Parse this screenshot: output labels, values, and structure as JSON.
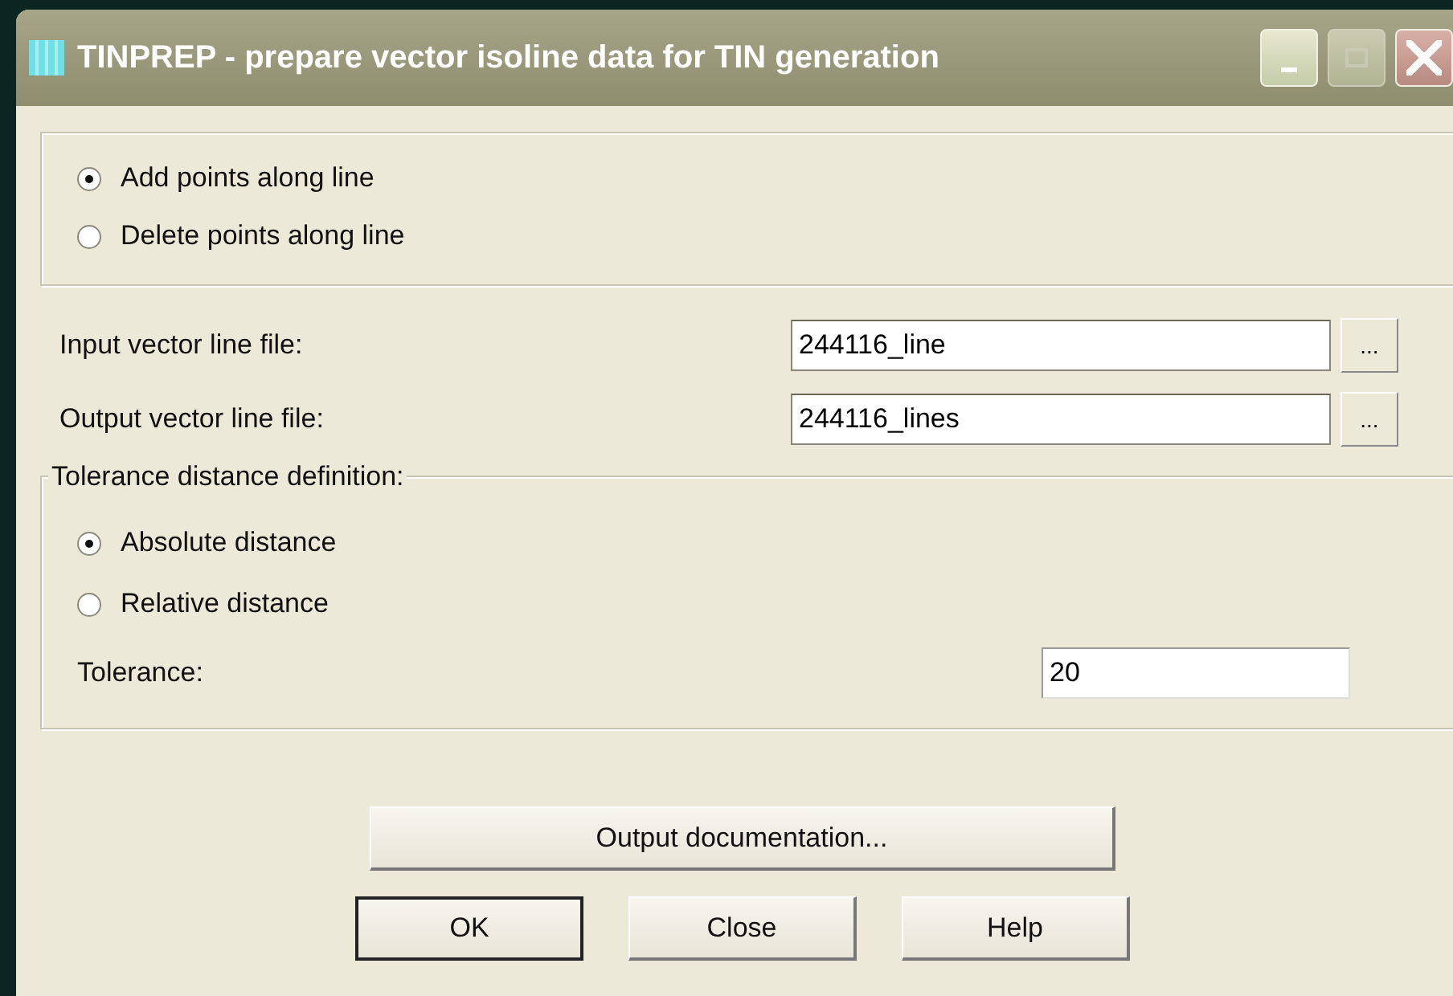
{
  "window": {
    "title": "TINPREP - prepare vector isoline data for TIN generation",
    "buttons": [
      {
        "kind": "minimize",
        "disabled": false
      },
      {
        "kind": "maximize",
        "disabled": true
      },
      {
        "kind": "close",
        "disabled": false
      }
    ]
  },
  "mode": [
    {
      "label": "Add points along line",
      "selected": true
    },
    {
      "label": "Delete points along line",
      "selected": false
    }
  ],
  "files": [
    {
      "label": "Input vector line file:",
      "value": "244116_line",
      "browse": "..."
    },
    {
      "label": "Output vector line file:",
      "value": "244116_lines",
      "browse": "..."
    }
  ],
  "tolerance_group": {
    "legend": "Tolerance distance definition:",
    "options": [
      {
        "label": "Absolute distance",
        "selected": true
      },
      {
        "label": "Relative distance",
        "selected": false
      }
    ],
    "tolerance_label": "Tolerance:",
    "tolerance_value": "20"
  },
  "doc_button": "Output documentation...",
  "buttons": [
    {
      "label": "OK",
      "default": true
    },
    {
      "label": "Close",
      "default": false
    },
    {
      "label": "Help",
      "default": false
    }
  ]
}
